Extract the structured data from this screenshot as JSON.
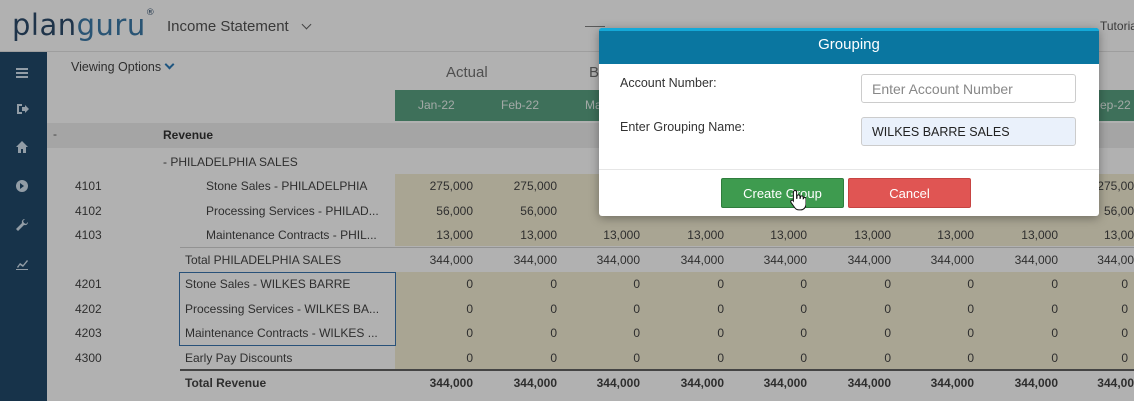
{
  "app": {
    "logo_left": "plan",
    "logo_right": "guru",
    "logo_mark": "®",
    "report_name": "Income Statement",
    "tutorial": "Tutoria"
  },
  "sidebar": {
    "icons": [
      "menu-icon",
      "logout-icon",
      "home-icon",
      "arrow-circle-icon",
      "wrench-icon",
      "chart-icon"
    ]
  },
  "toolbar": {
    "viewing_options": "Viewing Options"
  },
  "table": {
    "section_actual": "Actual",
    "section_budget": "B",
    "months": [
      "Jan-22",
      "Feb-22",
      "Ma",
      "",
      "",
      "",
      "",
      "",
      "",
      "ep-22"
    ],
    "revenue_dash": "-",
    "revenue_label": "Revenue",
    "group_label": "-  PHILADELPHIA SALES",
    "rows": [
      {
        "acct": "4101",
        "name": "Stone Sales - PHILADELPHIA",
        "values": [
          "275,000",
          "275,000",
          "2",
          "",
          "",
          "",
          "",
          "",
          "",
          "275,00"
        ]
      },
      {
        "acct": "4102",
        "name": "Processing Services - PHILAD...",
        "values": [
          "56,000",
          "56,000",
          "",
          "",
          "",
          "",
          "",
          "",
          "",
          "56,00"
        ]
      },
      {
        "acct": "4103",
        "name": "Maintenance Contracts - PHIL...",
        "values": [
          "13,000",
          "13,000",
          "13,000",
          "13,000",
          "13,000",
          "13,000",
          "13,000",
          "13,000",
          "13,000",
          "13,00"
        ]
      },
      {
        "acct": "",
        "name": "Total PHILADELPHIA SALES",
        "values": [
          "344,000",
          "344,000",
          "344,000",
          "344,000",
          "344,000",
          "344,000",
          "344,000",
          "344,000",
          "344,000",
          "344,00"
        ]
      },
      {
        "acct": "4201",
        "name": "Stone Sales - WILKES BARRE",
        "values": [
          "0",
          "0",
          "0",
          "0",
          "0",
          "0",
          "0",
          "0",
          "0",
          ""
        ]
      },
      {
        "acct": "4202",
        "name": "Processing Services - WILKES BA...",
        "values": [
          "0",
          "0",
          "0",
          "0",
          "0",
          "0",
          "0",
          "0",
          "0",
          ""
        ]
      },
      {
        "acct": "4203",
        "name": "Maintenance Contracts - WILKES ...",
        "values": [
          "0",
          "0",
          "0",
          "0",
          "0",
          "0",
          "0",
          "0",
          "0",
          ""
        ]
      },
      {
        "acct": "4300",
        "name": "Early Pay Discounts",
        "values": [
          "0",
          "0",
          "0",
          "0",
          "0",
          "0",
          "0",
          "0",
          "0",
          ""
        ]
      },
      {
        "acct": "",
        "name": "Total Revenue",
        "values": [
          "344,000",
          "344,000",
          "344,000",
          "344,000",
          "344,000",
          "344,000",
          "344,000",
          "344,000",
          "344,000",
          "344,00"
        ]
      }
    ]
  },
  "dialog": {
    "title": "Grouping",
    "account_number_label": "Account Number:",
    "account_number_placeholder": "Enter Account Number",
    "account_number_value": "",
    "grouping_name_label": "Enter Grouping Name:",
    "grouping_name_value": "WILKES BARRE SALES",
    "create_label": "Create Group",
    "cancel_label": "Cancel"
  },
  "colors": {
    "sidebar": "#0f3b5f",
    "month_bar": "#4c9a78",
    "dialog_header": "#0a76a0",
    "create_button": "#3e9b4f",
    "cancel_button": "#e05553",
    "value_band": "#f3ecd1"
  }
}
